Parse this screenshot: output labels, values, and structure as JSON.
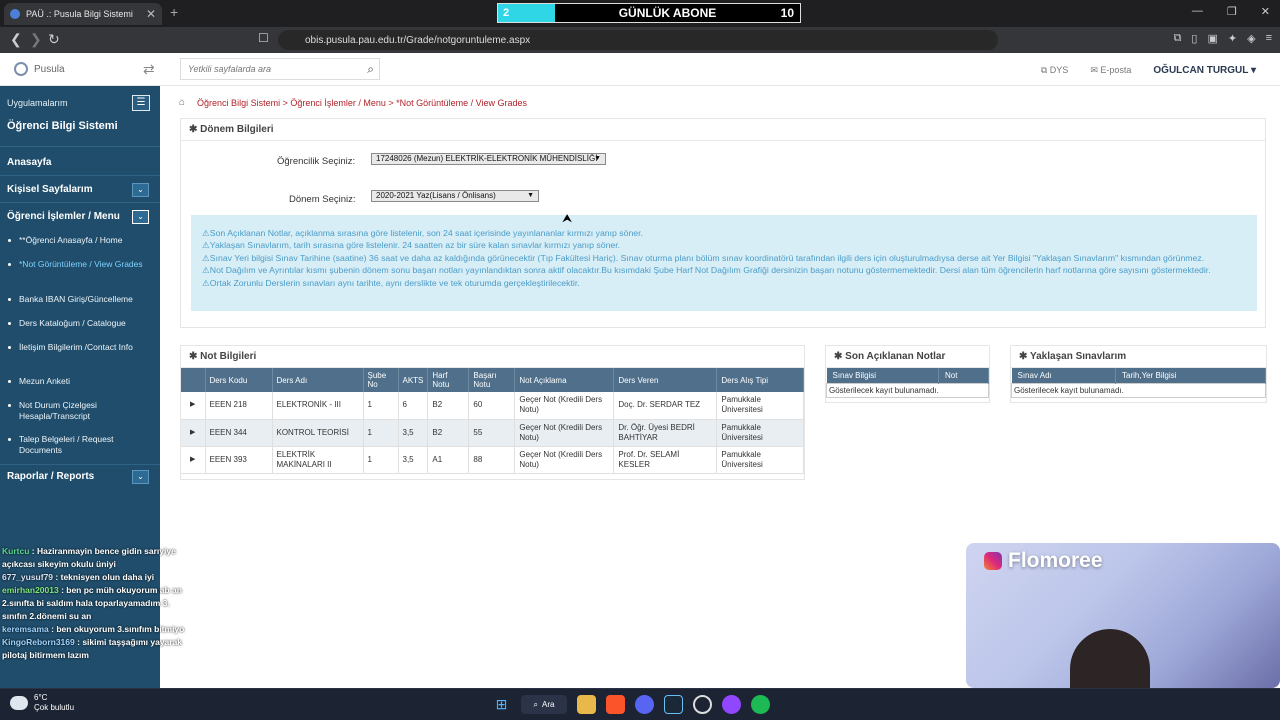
{
  "browser": {
    "tab_title": "PAÜ .: Pusula Bilgi Sistemi",
    "url": "obis.pusula.pau.edu.tr/Grade/notgoruntuleme.aspx"
  },
  "overlay_sub": {
    "left": "2",
    "title": "GÜNLÜK ABONE",
    "right": "10"
  },
  "header": {
    "logo": "Pusula",
    "search_placeholder": "Yetkili sayfalarda ara",
    "dys": "DYS",
    "eposta": "E-posta",
    "user": "OĞULCAN TURGUL ▾"
  },
  "sidebar": {
    "apps_label": "Uygulamalarım",
    "title": "Öğrenci Bilgi Sistemi",
    "home": "Anasayfa",
    "personal": "Kişisel Sayfalarım",
    "ops": "Öğrenci İşlemler / Menu",
    "items": [
      "**Öğrenci Anasayfa / Home",
      "*Not Görüntüleme / View Grades",
      "Banka IBAN Giriş/Güncelleme",
      "Ders Kataloğum / Catalogue",
      "İletişim Bilgilerim /Contact Info",
      "Mezun Anketi",
      "Not Durum Çizelgesi Hesapla/Transcript",
      "Talep Belgeleri / Request Documents"
    ],
    "reports": "Raporlar / Reports"
  },
  "chat": [
    {
      "user": "Kurtcu",
      "msg": "Haziranmayin bence gidin sarıyiye açıkcası sikeyim okulu üniyi"
    },
    {
      "user": "677_yusuf79",
      "msg": "teknisyen olun daha iyi"
    },
    {
      "user": "emirhan20013",
      "msg": "ben pc müh okuyorum ab an 2.sınıfta bi saldım hala toparlayamadım 3. sınıfın 2.dönemi su an"
    },
    {
      "user": "keremsama",
      "msg": "ben okuyorum 3.sınıfım bitmiyo"
    },
    {
      "user": "KingoReborn3169",
      "msg": "sikimi taşşağımı yayarak pilotaj bitirmem lazım"
    }
  ],
  "breadcrumb": [
    "Öğrenci Bilgi Sistemi > Öğrenci İşlemler / Menu > *Not Görüntüleme / View Grades"
  ],
  "donem": {
    "heading": "Dönem Bilgileri",
    "ogrencilik_label": "Öğrencilik Seçiniz:",
    "ogrencilik_value": "17248026 (Mezun) ELEKTRİK-ELEKTRONİK MÜHENDİSLİĞİ",
    "donem_label": "Dönem Seçiniz:",
    "donem_value": "2020-2021 Yaz(Lisans / Önlisans)",
    "info": [
      "Son Açıklanan Notlar, açıklanma sırasına göre listelenir, son 24 saat içerisinde yayınlananlar kırmızı yanıp söner.",
      "Yaklaşan Sınavlarım, tarih sırasına göre listelenir. 24 saatten az bir süre kalan sınavlar kırmızı yanıp söner.",
      "Sınav Yeri bilgisi Sınav Tarihine (saatine) 36 saat ve daha az kaldığında görünecektir (Tıp Fakültesi Hariç). Sınav oturma planı bölüm sınav koordinatörü tarafından ilgili ders için oluşturulmadıysa derse ait Yer Bilgisi \"Yaklaşan Sınavlarım\" kısmından görünmez.",
      "Not Dağılım ve Ayrıntılar kısmı şubenin dönem sonu başarı notları yayınlandıktan sonra aktif olacaktır.Bu kısımdaki Şube Harf Not Dağılım Grafiği dersinizin başarı notunu göstermemektedir. Dersi alan tüm öğrencilerin harf notlarına göre sayısını göstermektedir.",
      "Ortak Zorunlu Derslerin sınavları aynı tarihte, aynı derslikte ve tek oturumda gerçekleştirilecektir."
    ]
  },
  "grades": {
    "heading": "Not Bilgileri",
    "columns": [
      "Ders Kodu",
      "Ders Adı",
      "Şube No",
      "AKTS",
      "Harf Notu",
      "Başarı Notu",
      "Not Açıklama",
      "Ders Veren",
      "Ders Alış Tipi"
    ],
    "rows": [
      [
        "EEEN 218",
        "ELEKTRONİK - III",
        "1",
        "6",
        "B2",
        "60",
        "Geçer Not (Kredili Ders Notu)",
        "Doç. Dr. SERDAR TEZ",
        "Pamukkale Üniversitesi"
      ],
      [
        "EEEN 344",
        "KONTROL TEORİSİ",
        "1",
        "3,5",
        "B2",
        "55",
        "Geçer Not (Kredili Ders Notu)",
        "Dr. Öğr. Üyesi BEDRİ BAHTİYAR",
        "Pamukkale Üniversitesi"
      ],
      [
        "EEEN 393",
        "ELEKTRİK MAKİNALARI II",
        "1",
        "3,5",
        "A1",
        "88",
        "Geçer Not (Kredili Ders Notu)",
        "Prof. Dr. SELAMİ KESLER",
        "Pamukkale Üniversitesi"
      ]
    ]
  },
  "recent": {
    "heading": "Son Açıklanan Notlar",
    "col1": "Sınav Bilgisi",
    "col2": "Not",
    "empty": "Gösterilecek kayıt bulunamadı."
  },
  "upcoming": {
    "heading": "Yaklaşan Sınavlarım",
    "col1": "Sınav Adı",
    "col2": "Tarih,Yer Bilgisi",
    "empty": "Gösterilecek kayıt bulunamadı."
  },
  "webcam": {
    "name": "Flomoree"
  },
  "taskbar": {
    "temp": "6°C",
    "weather": "Çok bulutlu",
    "search": "Ara"
  }
}
